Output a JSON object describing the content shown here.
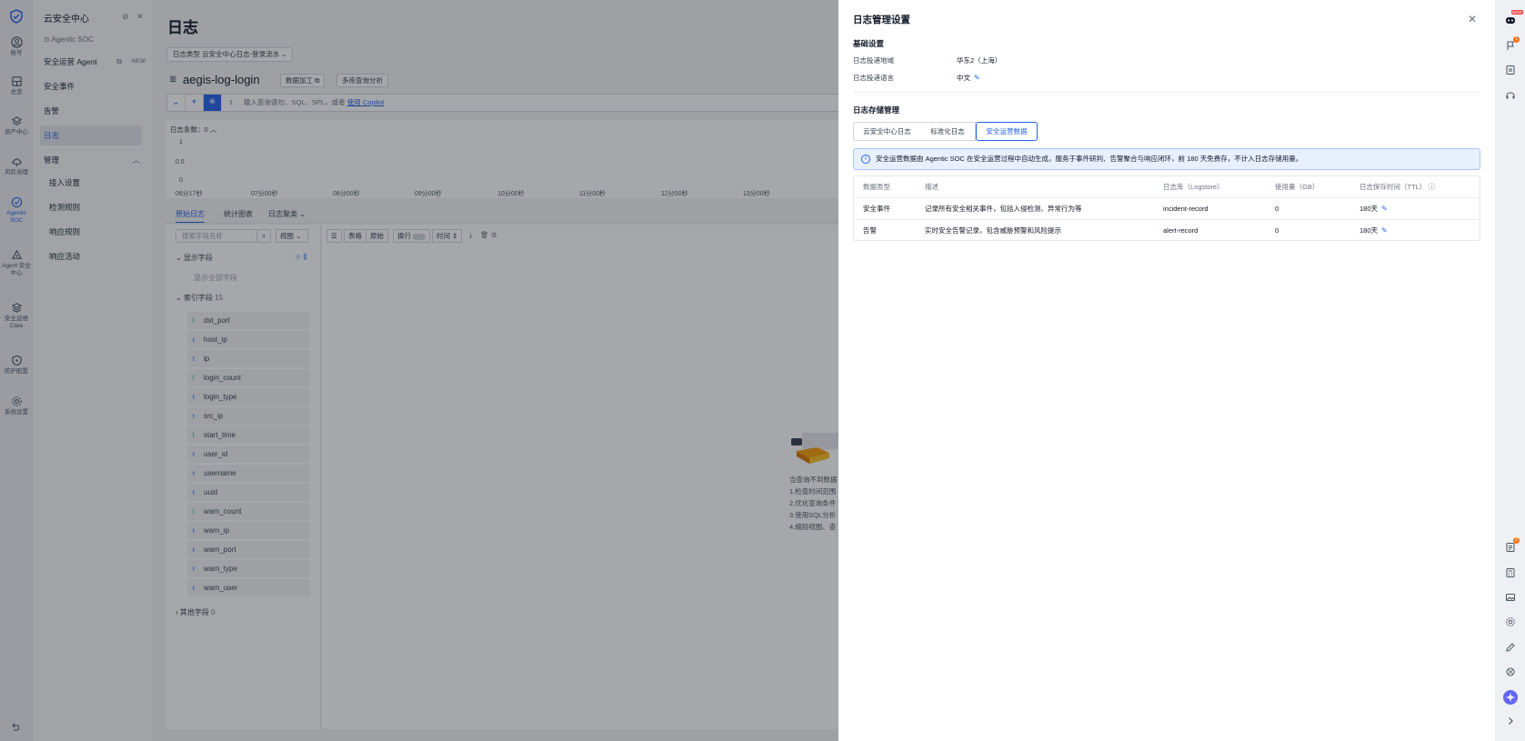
{
  "rail": {
    "items": [
      {
        "label": "账号",
        "icon": "user-circle-icon"
      },
      {
        "label": "总览",
        "icon": "dashboard-icon"
      },
      {
        "label": "资产中心",
        "icon": "layers-icon"
      },
      {
        "label": "风险治理",
        "icon": "cloud-icon"
      },
      {
        "label": "Agentic SOC",
        "icon": "shield-soc-icon"
      },
      {
        "label": "Agent 安全中心",
        "icon": "agent-icon"
      },
      {
        "label": "安全运维 Claw",
        "icon": "stack-icon"
      },
      {
        "label": "防护配置",
        "icon": "shield-icon"
      },
      {
        "label": "系统设置",
        "icon": "gear-icon"
      }
    ]
  },
  "subnav": {
    "title": "云安全中心",
    "soc_label": "Agentic SOC",
    "agent_label": "安全运营 Agent",
    "new_tag": "NEW",
    "items": {
      "events": "安全事件",
      "alerts": "告警",
      "logs": "日志",
      "manage": "管理",
      "access": "接入设置",
      "detect": "检测规则",
      "response": "响应规则",
      "activity": "响应活动"
    }
  },
  "main": {
    "page_title": "日志",
    "logtype": "日志类型 云安全中心日志-登录流水",
    "store_name": "aegis-log-login",
    "btn_process": "数据加工",
    "btn_multi": "多库查询分析",
    "query_line": "1",
    "query_placeholder": "输入查询语句、SQL、SPL，或者",
    "copilot_link": "使用 Copilot",
    "chart": {
      "count_label": "日志条数：0",
      "y_ticks": [
        "1",
        "0.5",
        "0"
      ],
      "x_ticks": [
        "06分17秒",
        "07分00秒",
        "08分00秒",
        "09分00秒",
        "10分00秒",
        "11分00秒",
        "12分00秒",
        "13分00秒"
      ]
    },
    "tabs": [
      "原始日志",
      "统计图表",
      "日志聚类"
    ],
    "search_placeholder": "搜索字段名称",
    "view_label": "视图",
    "tools": {
      "table": "表格",
      "raw": "原始",
      "wrap": "换行",
      "time": "时间"
    },
    "display_fields": "显示字段",
    "show_all": "显示全部字段",
    "index_fields": "索引字段",
    "index_count": "15",
    "other_fields": "其他字段",
    "other_count": "0",
    "fields": [
      {
        "type": "l",
        "name": "dst_port"
      },
      {
        "type": "t",
        "name": "host_ip"
      },
      {
        "type": "t",
        "name": "ip"
      },
      {
        "type": "l",
        "name": "login_count"
      },
      {
        "type": "t",
        "name": "login_type"
      },
      {
        "type": "t",
        "name": "src_ip"
      },
      {
        "type": "l",
        "name": "start_time"
      },
      {
        "type": "t",
        "name": "user_id"
      },
      {
        "type": "t",
        "name": "username"
      },
      {
        "type": "t",
        "name": "uuid"
      },
      {
        "type": "l",
        "name": "warn_count"
      },
      {
        "type": "t",
        "name": "warn_ip"
      },
      {
        "type": "t",
        "name": "warn_port"
      },
      {
        "type": "t",
        "name": "warn_type"
      },
      {
        "type": "t",
        "name": "warn_user"
      }
    ],
    "empty_lines": [
      "当查询不到数据",
      "1.检查时间范围",
      "2.优化查询条件",
      "3.使用SQL分析",
      "4.缩短视图、查"
    ]
  },
  "drawer": {
    "title": "日志管理设置",
    "basic_title": "基础设置",
    "region_label": "日志投递地域",
    "region_value": "华东2（上海）",
    "lang_label": "日志投递语言",
    "lang_value": "中文",
    "storage_title": "日志存储管理",
    "segments": [
      "云安全中心日志",
      "标准化日志",
      "安全运营数据"
    ],
    "info": "安全运营数据由 Agentic SOC 在安全运营过程中自动生成，服务于事件研判、告警聚合与响应闭环，前 180 天免费存，不计入日志存储用量。",
    "table": {
      "headers": [
        "数据类型",
        "描述",
        "日志库（Logstore）",
        "使用量（GB）",
        "日志保存时间（TTL）"
      ],
      "rows": [
        {
          "type": "安全事件",
          "desc": "记录所有安全相关事件，包括入侵检测、异常行为等",
          "store": "incident-record",
          "usage": "0",
          "ttl": "180天"
        },
        {
          "type": "告警",
          "desc": "实时安全告警记录，包含威胁预警和风险提示",
          "store": "alert-record",
          "usage": "0",
          "ttl": "180天"
        }
      ]
    }
  },
  "right_rail": {
    "new_badge": "NEW",
    "badge1": "1",
    "badge2": "2"
  }
}
